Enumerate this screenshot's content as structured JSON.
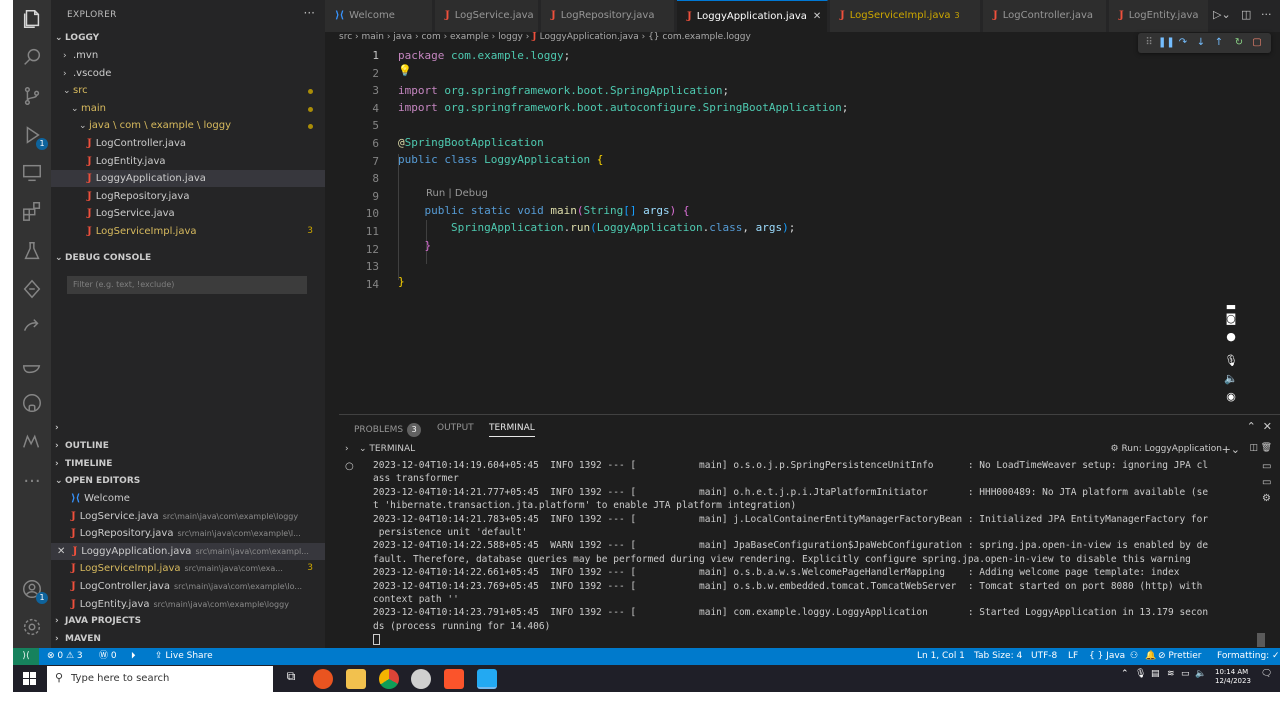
{
  "sidebar": {
    "title": "EXPLORER",
    "project": "LOGGY",
    "tree": [
      {
        "label": ".mvn",
        "depth": 1,
        "chev": "›"
      },
      {
        "label": ".vscode",
        "depth": 1,
        "chev": "›"
      },
      {
        "label": "src",
        "depth": 1,
        "chev": "⌄",
        "yellow": true,
        "dot": true
      },
      {
        "label": "main",
        "depth": 2,
        "chev": "⌄",
        "yellow": true,
        "dot": true
      },
      {
        "label": "java \\ com \\ example \\ loggy",
        "depth": 3,
        "chev": "⌄",
        "yellow": true,
        "dot": true
      },
      {
        "label": "LogController.java",
        "depth": 4,
        "java": true
      },
      {
        "label": "LogEntity.java",
        "depth": 4,
        "java": true
      },
      {
        "label": "LoggyApplication.java",
        "depth": 4,
        "java": true,
        "selected": true
      },
      {
        "label": "LogRepository.java",
        "depth": 4,
        "java": true
      },
      {
        "label": "LogService.java",
        "depth": 4,
        "java": true
      },
      {
        "label": "LogServiceImpl.java",
        "depth": 4,
        "java": true,
        "yellow": true,
        "count": "3"
      }
    ],
    "debug_console": {
      "title": "DEBUG CONSOLE",
      "filter_placeholder": "Filter (e.g. text, !exclude)"
    },
    "outline": "OUTLINE",
    "timeline": "TIMELINE",
    "open_editors": {
      "title": "OPEN EDITORS",
      "items": [
        {
          "label": "Welcome",
          "path": "",
          "vs": true
        },
        {
          "label": "LogService.java",
          "path": "src\\main\\java\\com\\example\\loggy"
        },
        {
          "label": "LogRepository.java",
          "path": "src\\main\\java\\com\\example\\l..."
        },
        {
          "label": "LoggyApplication.java",
          "path": "src\\main\\java\\com\\exampl...",
          "close": true,
          "selected": true
        },
        {
          "label": "LogServiceImpl.java",
          "path": "src\\main\\java\\com\\exa...",
          "yellow": true,
          "count": "3"
        },
        {
          "label": "LogController.java",
          "path": "src\\main\\java\\com\\example\\lo..."
        },
        {
          "label": "LogEntity.java",
          "path": "src\\main\\java\\com\\example\\loggy"
        }
      ]
    },
    "java_projects": "JAVA PROJECTS",
    "maven": "MAVEN"
  },
  "tabs": [
    {
      "label": "Welcome",
      "vs": true
    },
    {
      "label": "LogService.java"
    },
    {
      "label": "LogRepository.java"
    },
    {
      "label": "LoggyApplication.java",
      "active": true
    },
    {
      "label": "LogServiceImpl.java",
      "warn": true,
      "count": "3"
    },
    {
      "label": "LogController.java"
    },
    {
      "label": "LogEntity.java"
    }
  ],
  "breadcrumb": {
    "parts": [
      "src",
      "main",
      "java",
      "com",
      "example",
      "loggy"
    ],
    "file": "LoggyApplication.java",
    "symbol": "{} com.example.loggy"
  },
  "editor": {
    "line_numbers": [
      "1",
      "2",
      "3",
      "4",
      "5",
      "6",
      "7",
      "8",
      "9",
      "10",
      "11",
      "12",
      "13",
      "14"
    ],
    "codelens": "Run | Debug"
  },
  "panel": {
    "tabs": [
      {
        "label": "PROBLEMS",
        "badge": "3"
      },
      {
        "label": "OUTPUT"
      },
      {
        "label": "TERMINAL",
        "active": true
      }
    ],
    "terminal_title": "TERMINAL",
    "run_label": "Run: LoggyApplication",
    "lines": [
      "2023-12-04T10:14:19.604+05:45  INFO 1392 --- [           main] o.s.o.j.p.SpringPersistenceUnitInfo      : No LoadTimeWeaver setup: ignoring JPA cl",
      "ass transformer",
      "2023-12-04T10:14:21.777+05:45  INFO 1392 --- [           main] o.h.e.t.j.p.i.JtaPlatformInitiator       : HHH000489: No JTA platform available (se",
      "t 'hibernate.transaction.jta.platform' to enable JTA platform integration)",
      "2023-12-04T10:14:21.783+05:45  INFO 1392 --- [           main] j.LocalContainerEntityManagerFactoryBean : Initialized JPA EntityManagerFactory for",
      " persistence unit 'default'",
      "2023-12-04T10:14:22.588+05:45  WARN 1392 --- [           main] JpaBaseConfiguration$JpaWebConfiguration : spring.jpa.open-in-view is enabled by de",
      "fault. Therefore, database queries may be performed during view rendering. Explicitly configure spring.jpa.open-in-view to disable this warning",
      "2023-12-04T10:14:22.661+05:45  INFO 1392 --- [           main] o.s.b.a.w.s.WelcomePageHandlerMapping    : Adding welcome page template: index",
      "2023-12-04T10:14:23.769+05:45  INFO 1392 --- [           main] o.s.b.w.embedded.tomcat.TomcatWebServer  : Tomcat started on port 8080 (http) with",
      "context path ''",
      "2023-12-04T10:14:23.791+05:45  INFO 1392 --- [           main] com.example.loggy.LoggyApplication       : Started LoggyApplication in 13.179 secon",
      "ds (process running for 14.406)"
    ]
  },
  "statusbar": {
    "problems": "⊗ 0 ⚠ 3",
    "ports": "Ⓦ 0",
    "live_share": "Live Share",
    "cursor": "Ln 1, Col 1",
    "tab_size": "Tab Size: 4",
    "encoding": "UTF-8",
    "eol": "LF",
    "language": "{ } Java",
    "prettier": "Prettier",
    "formatting": "Formatting: ✓"
  },
  "taskbar": {
    "search_placeholder": "Type here to search",
    "time": "10:14 AM",
    "date": "12/4/2023"
  },
  "colors": {
    "accent": "#007acc",
    "java_icon": "#f0503c",
    "warning": "#cca700"
  }
}
